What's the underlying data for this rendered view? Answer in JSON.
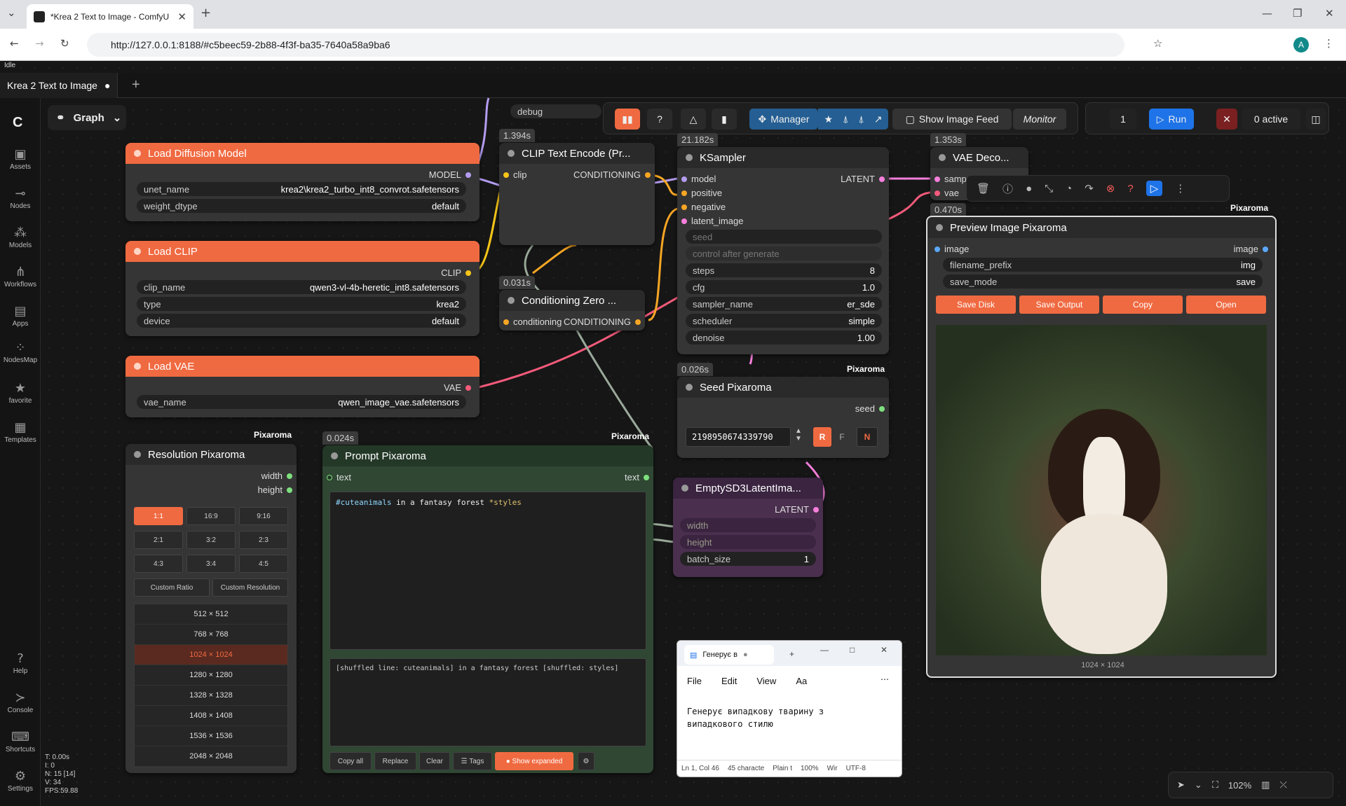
{
  "browser": {
    "tab_title": "*Krea 2 Text to Image - ComfyU",
    "new_tab": "+",
    "url": "http://127.0.0.1:8188/#c5beec59-2b88-4f3f-ba35-7640a58a9ba6",
    "profile": "A"
  },
  "status": "Idle",
  "workflow_tab": {
    "label": "Krea 2 Text to Image",
    "dot": "●",
    "add": "+"
  },
  "graph_button": "Graph",
  "sidebar": [
    {
      "icon": "assets-icon",
      "label": "Assets"
    },
    {
      "icon": "nodes-icon",
      "label": "Nodes"
    },
    {
      "icon": "models-icon",
      "label": "Models"
    },
    {
      "icon": "workflows-icon",
      "label": "Workflows"
    },
    {
      "icon": "apps-icon",
      "label": "Apps"
    },
    {
      "icon": "nodesmap-icon",
      "label": "NodesMap"
    },
    {
      "icon": "star-icon",
      "label": "favorite"
    },
    {
      "icon": "templates-icon",
      "label": "Templates"
    },
    {
      "icon": "help-icon",
      "label": "Help"
    },
    {
      "icon": "console-icon",
      "label": "Console"
    },
    {
      "icon": "shortcuts-icon",
      "label": "Shortcuts"
    },
    {
      "icon": "gear-icon",
      "label": "Settings"
    }
  ],
  "stats": [
    "T: 0.00s",
    "I: 0",
    "N: 15 [14]",
    "V: 34",
    "FPS:59.88"
  ],
  "toolbar": {
    "manager": "Manager",
    "show_image_feed": "Show Image Feed",
    "monitor": "Monitor",
    "debug": "debug"
  },
  "run": {
    "count": "1",
    "label": "Run",
    "active": "0 active"
  },
  "nodes": {
    "load_diffusion": {
      "title": "Load Diffusion Model",
      "out": "MODEL",
      "w": [
        [
          "unet_name",
          "krea2\\krea2_turbo_int8_convrot.safetensors"
        ],
        [
          "weight_dtype",
          "default"
        ]
      ]
    },
    "load_clip": {
      "title": "Load CLIP",
      "out": "CLIP",
      "w": [
        [
          "clip_name",
          "qwen3-vl-4b-heretic_int8.safetensors"
        ],
        [
          "type",
          "krea2"
        ],
        [
          "device",
          "default"
        ]
      ]
    },
    "load_vae": {
      "title": "Load VAE",
      "out": "VAE",
      "w": [
        [
          "vae_name",
          "qwen_image_vae.safetensors"
        ]
      ]
    },
    "clip_encode": {
      "title": "CLIP Text Encode (Pr...",
      "timing": "1.394s",
      "in": "clip",
      "out": "CONDITIONING"
    },
    "cond_zero": {
      "title": "Conditioning Zero ...",
      "timing": "0.031s",
      "in": "conditioning",
      "out": "CONDITIONING"
    },
    "ksampler": {
      "title": "KSampler",
      "timing": "21.182s",
      "inputs": [
        "model",
        "positive",
        "negative",
        "latent_image"
      ],
      "out": "LATENT",
      "seed": "seed",
      "cag": "control after generate",
      "w": [
        [
          "steps",
          "8"
        ],
        [
          "cfg",
          "1.0"
        ],
        [
          "sampler_name",
          "er_sde"
        ],
        [
          "scheduler",
          "simple"
        ],
        [
          "denoise",
          "1.00"
        ]
      ]
    },
    "vae_decode": {
      "title": "VAE Deco...",
      "timing": "1.353s",
      "inputs": [
        "samp",
        "vae"
      ]
    },
    "seed": {
      "title": "Seed Pixaroma",
      "timing": "0.026s",
      "out": "seed",
      "value": "2198950674339790",
      "r": "R",
      "f": "F",
      "n": "N"
    },
    "empty_latent": {
      "title": "EmptySD3LatentIma...",
      "out": "LATENT",
      "inputs": [
        "width",
        "height"
      ],
      "batch_label": "batch_size",
      "batch": "1"
    },
    "resolution": {
      "title": "Resolution Pixaroma",
      "outs": [
        "width",
        "height"
      ],
      "ratios": [
        "1:1",
        "16:9",
        "9:16",
        "2:1",
        "3:2",
        "2:3",
        "4:3",
        "3:4",
        "4:5"
      ],
      "custom": [
        "Custom Ratio",
        "Custom Resolution"
      ],
      "sizes": [
        "512 × 512",
        "768 × 768",
        "1024 × 1024",
        "1280 × 1280",
        "1328 × 1328",
        "1408 × 1408",
        "1536 × 1536",
        "2048 × 2048"
      ]
    },
    "prompt": {
      "title": "Prompt Pixaroma",
      "timing": "0.024s",
      "in": "text",
      "out": "text",
      "prompt_tag": "#cuteanimals",
      "prompt_mid": " in a fantasy forest ",
      "prompt_style": "*styles",
      "shuffled": "[shuffled line: cuteanimals] in a fantasy forest [shuffled: styles]",
      "buttons": [
        "Copy all",
        "Replace",
        "Clear",
        "☰ Tags",
        "● Show expanded"
      ]
    },
    "preview": {
      "title": "Preview Image Pixaroma",
      "timing": "0.470s",
      "in": "image",
      "out": "image",
      "w": [
        [
          "filename_prefix",
          "img"
        ],
        [
          "save_mode",
          "save"
        ]
      ],
      "buttons": [
        "Save Disk",
        "Save Output",
        "Copy",
        "Open"
      ],
      "size": "1024 × 1024"
    }
  },
  "pixaroma": "Pixaroma",
  "notepad": {
    "tab": "Генерує в",
    "menu": [
      "File",
      "Edit",
      "View"
    ],
    "text": "Генерує випадкову тварину з випадкового стилю",
    "status": [
      "Ln 1, Col 46",
      "45 characte",
      "Plain t",
      "100%",
      "Wir",
      "UTF-8"
    ]
  },
  "zoom": "102%"
}
